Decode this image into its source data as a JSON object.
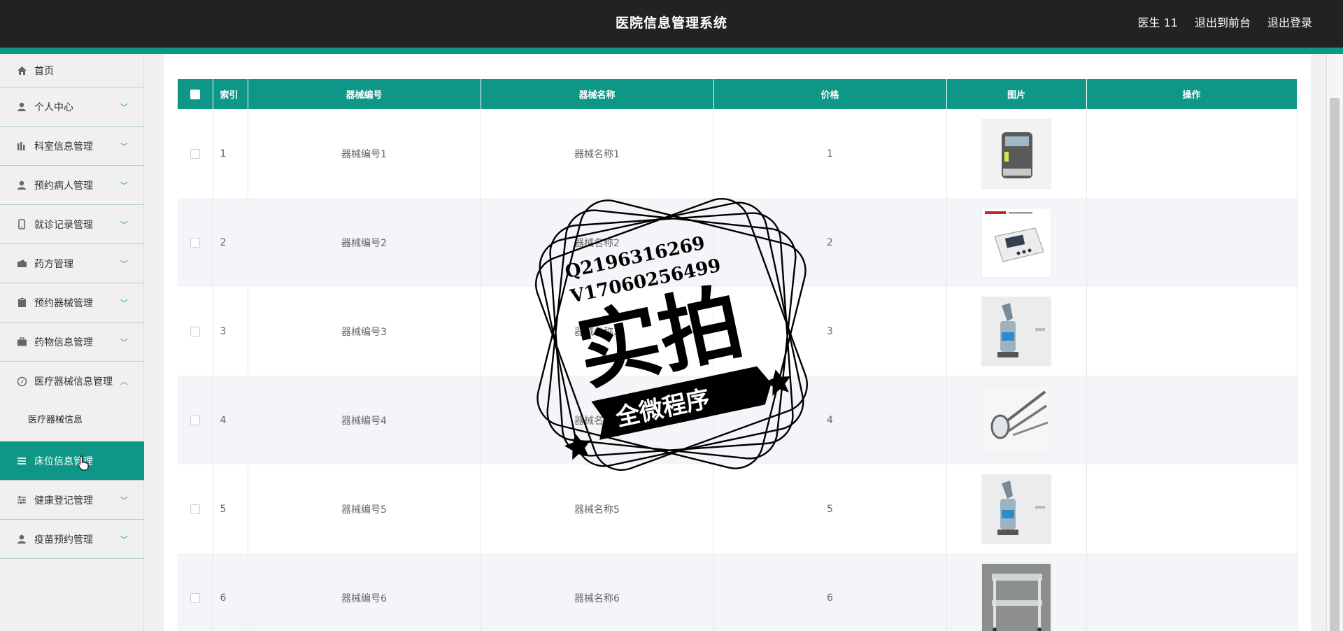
{
  "header": {
    "title": "医院信息管理系统",
    "user": "医生 11",
    "exit_front": "退出到前台",
    "logout": "退出登录"
  },
  "sidebar": {
    "items": [
      {
        "label": "首页",
        "icon": "home-icon"
      },
      {
        "label": "个人中心",
        "icon": "user-icon"
      },
      {
        "label": "科室信息管理",
        "icon": "chart-icon"
      },
      {
        "label": "预约病人管理",
        "icon": "user-icon"
      },
      {
        "label": "就诊记录管理",
        "icon": "phone-icon"
      },
      {
        "label": "药方管理",
        "icon": "wallet-icon"
      },
      {
        "label": "预约器械管理",
        "icon": "clipboard-icon"
      },
      {
        "label": "药物信息管理",
        "icon": "briefcase-icon"
      },
      {
        "label": "医疗器械信息管理",
        "icon": "compass-icon"
      },
      {
        "label": "床位信息管理",
        "icon": "list-icon"
      },
      {
        "label": "健康登记管理",
        "icon": "sliders-icon"
      },
      {
        "label": "疫苗预约管理",
        "icon": "user-icon"
      }
    ],
    "sub_item": "医疗器械信息"
  },
  "table": {
    "headers": [
      "索引",
      "器械编号",
      "器械名称",
      "价格",
      "图片",
      "操作"
    ],
    "rows": [
      {
        "idx": "1",
        "code": "器械编号1",
        "name": "器械名称1",
        "price": "1"
      },
      {
        "idx": "2",
        "code": "器械编号2",
        "name": "器械名称2",
        "price": "2"
      },
      {
        "idx": "3",
        "code": "器械编号3",
        "name": "器械名称3",
        "price": "3"
      },
      {
        "idx": "4",
        "code": "器械编号4",
        "name": "器械名称4",
        "price": "4"
      },
      {
        "idx": "5",
        "code": "器械编号5",
        "name": "器械名称5",
        "price": "5"
      },
      {
        "idx": "6",
        "code": "器械编号6",
        "name": "器械名称6",
        "price": "6"
      }
    ]
  },
  "watermark": {
    "line1": "Q2196316269",
    "line2": "V17060256499",
    "big": "实拍",
    "banner": "全微程序"
  },
  "colors": {
    "accent": "#0e9686",
    "topbar": "#222222"
  }
}
